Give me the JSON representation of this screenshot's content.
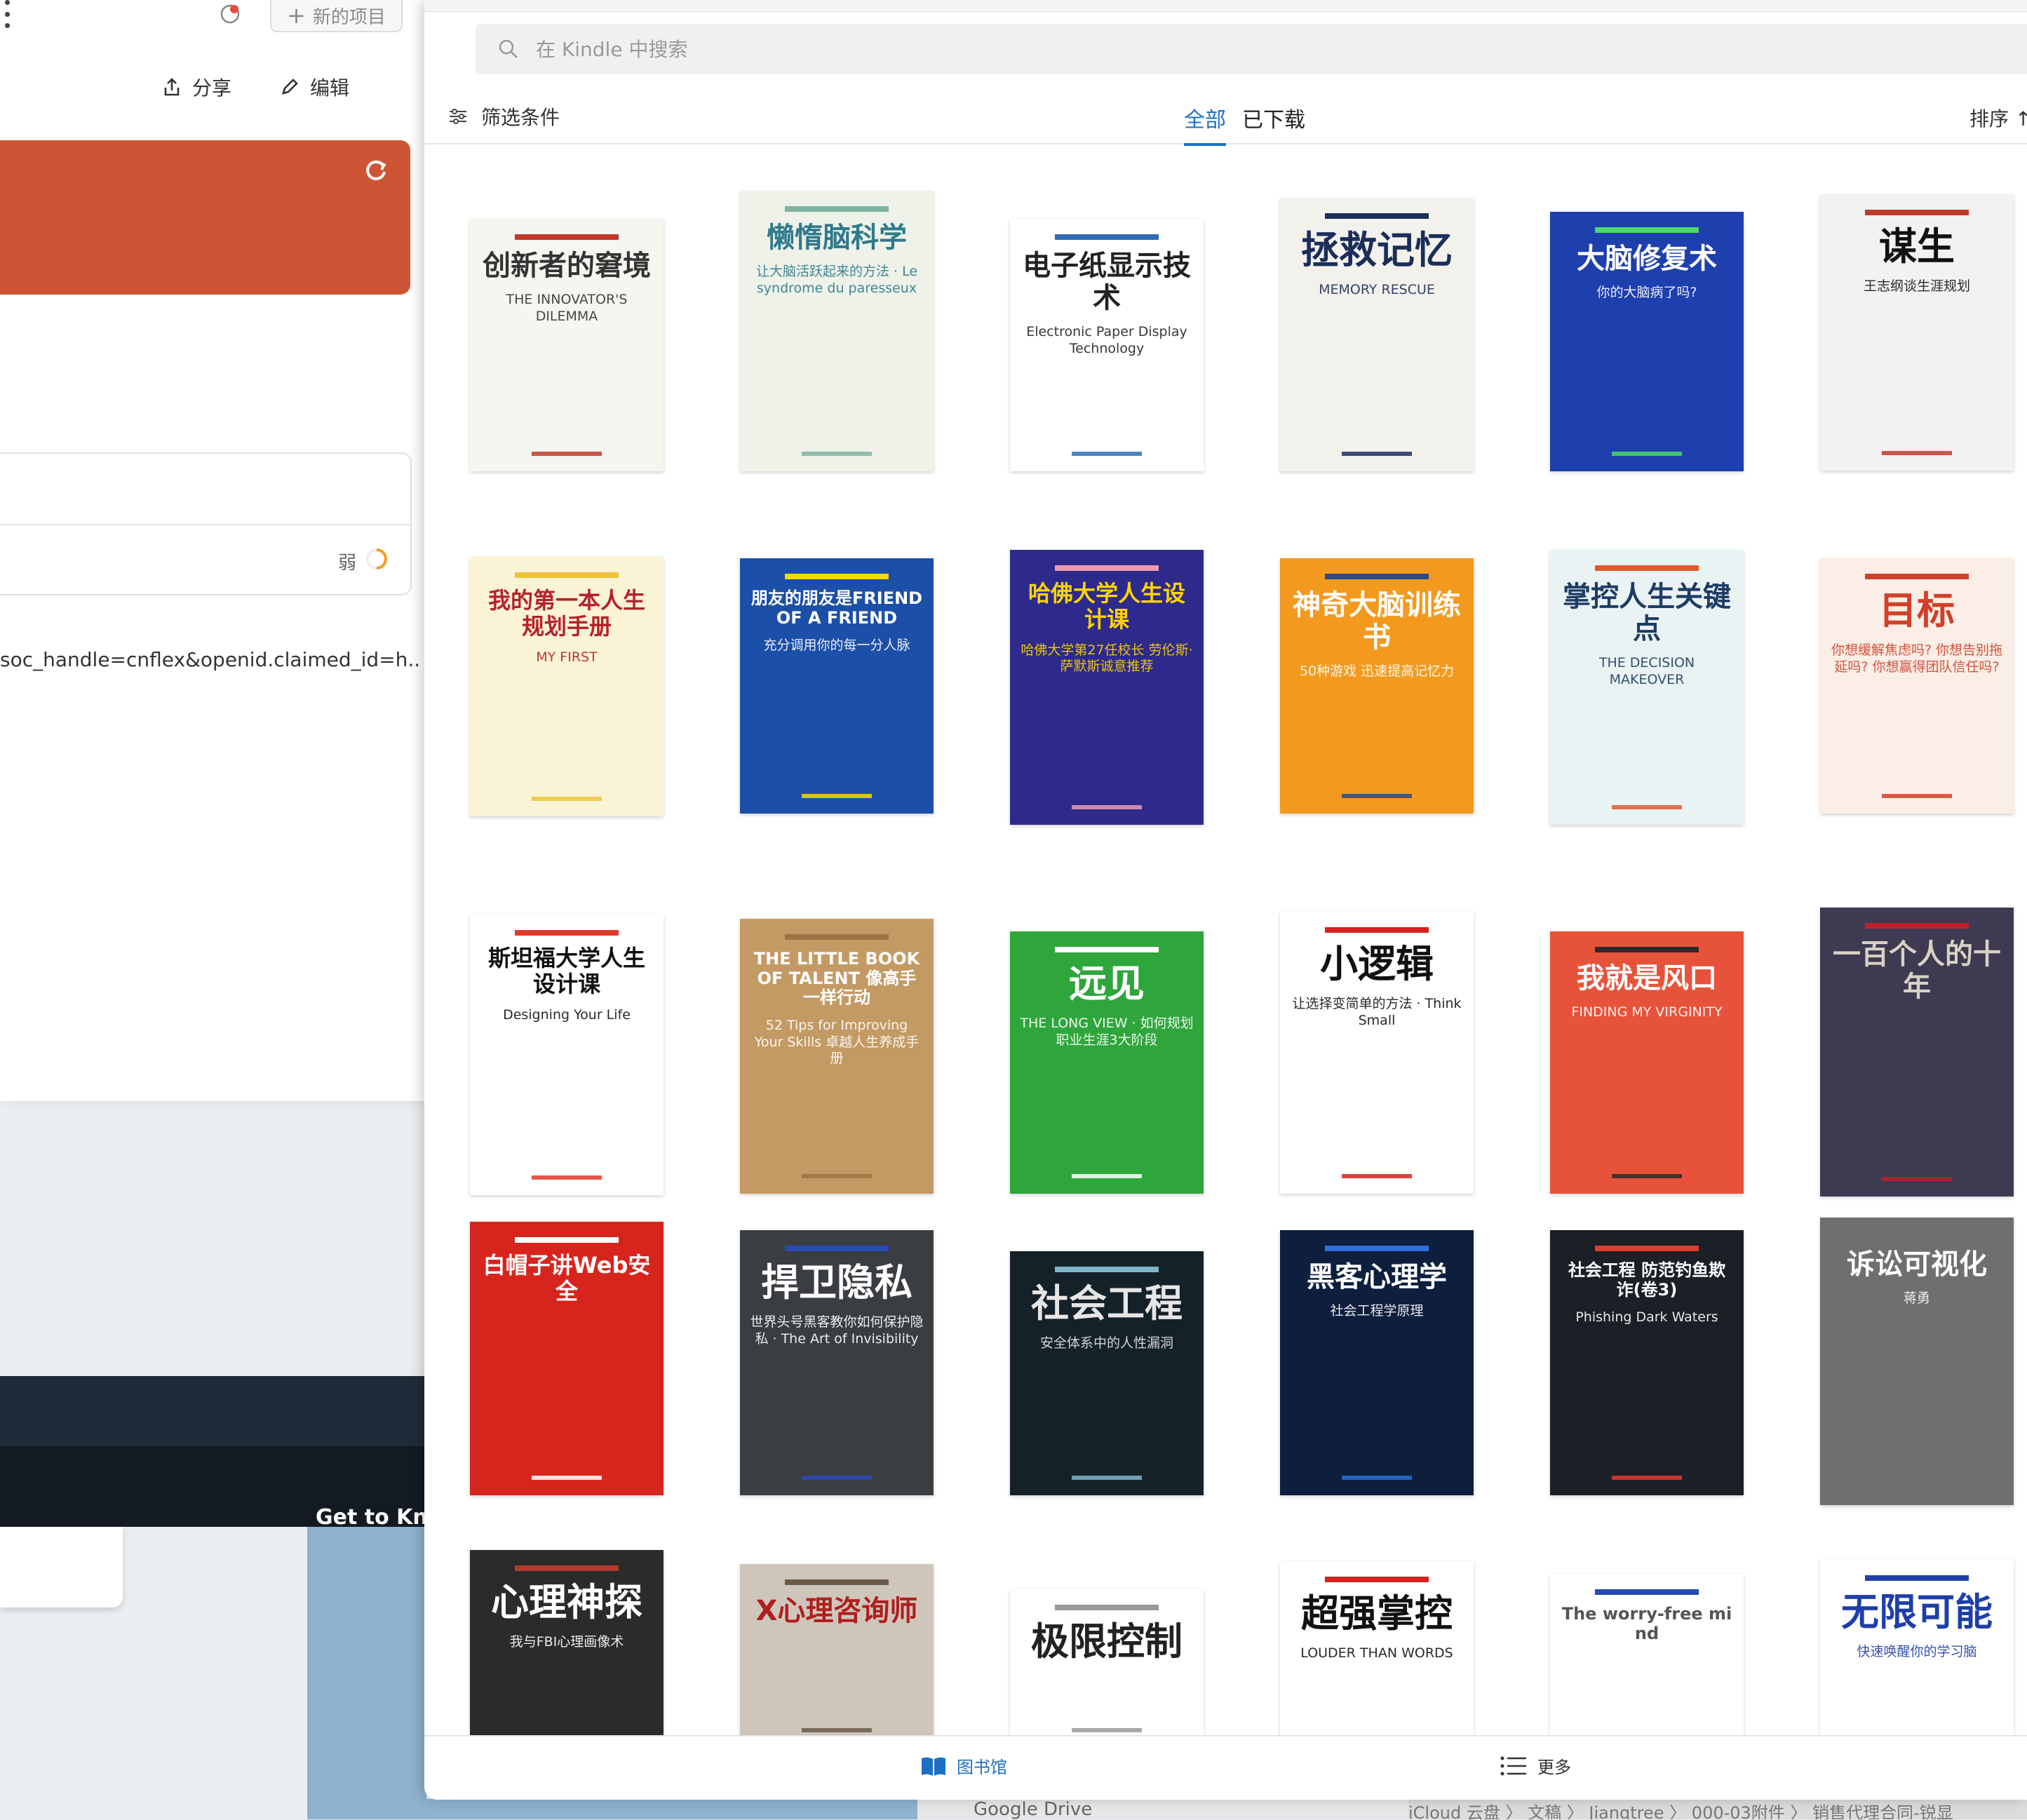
{
  "left_window": {
    "new_project": "新的项目",
    "share_label": "分享",
    "edit_label": "编辑",
    "status_weak": "弱",
    "url_fragment": "soc_handle=cnflex&openid.claimed_id=h...",
    "get_to_know": "Get to Kno"
  },
  "taskbar": {
    "google_drive": "Google Drive",
    "finder_path": "iCloud 云盘 〉 文稿 〉 Jiangtree 〉 000-03附件 〉 销售代理合同-锐显"
  },
  "kindle": {
    "search_placeholder": "在 Kindle 中搜索",
    "filter_label": "筛选条件",
    "tab_all": "全部",
    "tab_downloaded": "已下载",
    "sort_label": "排序 ↑",
    "nav_library": "图书馆",
    "nav_more": "更多",
    "books": [
      {
        "title": "创新者的窘境",
        "subtitle": "THE INNOVATOR'S DILEMMA",
        "bg": "#f7f5f0",
        "fg": "#333333",
        "accent": "#c0392b"
      },
      {
        "title": "懒惰脑科学",
        "subtitle": "让大脑活跃起来的方法 · Le syndrome du paresseux",
        "bg": "#eef2e8",
        "fg": "#2f7a8c",
        "accent": "#7fb3a0"
      },
      {
        "title": "电子纸显示技术",
        "subtitle": "Electronic Paper Display Technology",
        "bg": "#ffffff",
        "fg": "#222222",
        "accent": "#2f6db5"
      },
      {
        "title": "拯救记忆",
        "subtitle": "MEMORY RESCUE",
        "bg": "#f3f1ec",
        "fg": "#1b2e5a",
        "accent": "#1b2e5a"
      },
      {
        "title": "大脑修复术",
        "subtitle": "你的大脑病了吗?",
        "bg": "#1e3fae",
        "fg": "#ffffff",
        "accent": "#4cd964"
      },
      {
        "title": "谋生",
        "subtitle": "王志纲谈生涯规划",
        "bg": "#f2f2f2",
        "fg": "#111111",
        "accent": "#c0392b"
      },
      {
        "title": "我的第一本人生规划手册",
        "subtitle": "MY FIRST",
        "bg": "#fbf3d6",
        "fg": "#b5222a",
        "accent": "#f0c33a"
      },
      {
        "title": "朋友的朋友是FRIEND OF A FRIEND",
        "subtitle": "充分调用你的每一分人脉",
        "bg": "#1c4fa8",
        "fg": "#ffffff",
        "accent": "#f5d900"
      },
      {
        "title": "哈佛大学人生设计课",
        "subtitle": "哈佛大学第27任校长 劳伦斯·萨默斯诚意推荐",
        "bg": "#2d2a8c",
        "fg": "#ffd400",
        "accent": "#ef9ab0"
      },
      {
        "title": "神奇大脑训练书",
        "subtitle": "50种游戏 迅速提高记忆力",
        "bg": "#f39a1e",
        "fg": "#ffffff",
        "accent": "#2a4a8c"
      },
      {
        "title": "掌控人生关键点",
        "subtitle": "THE DECISION MAKEOVER",
        "bg": "#eaf3f3",
        "fg": "#1d3c66",
        "accent": "#e05a2b"
      },
      {
        "title": "目标",
        "subtitle": "你想缓解焦虑吗? 你想告别拖延吗? 你想赢得团队信任吗?",
        "bg": "#fbeee6",
        "fg": "#d0402a",
        "accent": "#d0402a"
      },
      {
        "title": "斯坦福大学人生设计课",
        "subtitle": "Designing Your Life",
        "bg": "#ffffff",
        "fg": "#111111",
        "accent": "#e33a2a"
      },
      {
        "title": "THE LITTLE BOOK OF TALENT 像高手一样行动",
        "subtitle": "52 Tips for Improving Your Skills 卓越人生养成手册",
        "bg": "#c49a64",
        "fg": "#ffffff",
        "accent": "#9a7442"
      },
      {
        "title": "远见",
        "subtitle": "THE LONG VIEW · 如何规划职业生涯3大阶段",
        "bg": "#2fa63c",
        "fg": "#ffffff",
        "accent": "#ffffff"
      },
      {
        "title": "小逻辑",
        "subtitle": "让选择变简单的方法 · Think Small",
        "bg": "#ffffff",
        "fg": "#111111",
        "accent": "#d4221e"
      },
      {
        "title": "我就是风口",
        "subtitle": "FINDING MY VIRGINITY",
        "bg": "#e7533a",
        "fg": "#ffffff",
        "accent": "#2a2a2a"
      },
      {
        "title": "一百个人的十年",
        "subtitle": "",
        "bg": "#3d3a52",
        "fg": "#d9d2c4",
        "accent": "#c0202a"
      },
      {
        "title": "白帽子讲Web安全",
        "subtitle": "",
        "bg": "#d7251e",
        "fg": "#ffffff",
        "accent": "#ffffff"
      },
      {
        "title": "捍卫隐私",
        "subtitle": "世界头号黑客教你如何保护隐私 · The Art of Invisibility",
        "bg": "#3a3d42",
        "fg": "#ffffff",
        "accent": "#2a4ab8"
      },
      {
        "title": "社会工程",
        "subtitle": "安全体系中的人性漏洞",
        "bg": "#152129",
        "fg": "#e6e6e6",
        "accent": "#7fb5c8"
      },
      {
        "title": "黑客心理学",
        "subtitle": "社会工程学原理",
        "bg": "#0e1e3d",
        "fg": "#ffffff",
        "accent": "#2f6ed8"
      },
      {
        "title": "社会工程 防范钓鱼欺诈(卷3)",
        "subtitle": "Phishing Dark Waters",
        "bg": "#1b1f26",
        "fg": "#ffffff",
        "accent": "#e23b2e"
      },
      {
        "title": "诉讼可视化",
        "subtitle": "蒋勇",
        "bg": "#6f6f6f",
        "fg": "#ffffff",
        "accent": "#6f6f6f"
      },
      {
        "title": "心理神探",
        "subtitle": "我与FBI心理画像术",
        "bg": "#2b2b2b",
        "fg": "#ffffff",
        "accent": "#b23a2a"
      },
      {
        "title": "X心理咨询师",
        "subtitle": "",
        "bg": "#cfc6bb",
        "fg": "#b01e1e",
        "accent": "#6a5a4a"
      },
      {
        "title": "极限控制",
        "subtitle": "",
        "bg": "#ffffff",
        "fg": "#222222",
        "accent": "#999999"
      },
      {
        "title": "超强掌控",
        "subtitle": "LOUDER THAN WORDS",
        "bg": "#ffffff",
        "fg": "#111111",
        "accent": "#d4221e"
      },
      {
        "title": "The worry-free mind",
        "subtitle": "",
        "bg": "#ffffff",
        "fg": "#555555",
        "accent": "#2a4ab8"
      },
      {
        "title": "无限可能",
        "subtitle": "快速唤醒你的学习脑",
        "bg": "#ffffff",
        "fg": "#1e3fa8",
        "accent": "#1e3fa8"
      }
    ]
  }
}
